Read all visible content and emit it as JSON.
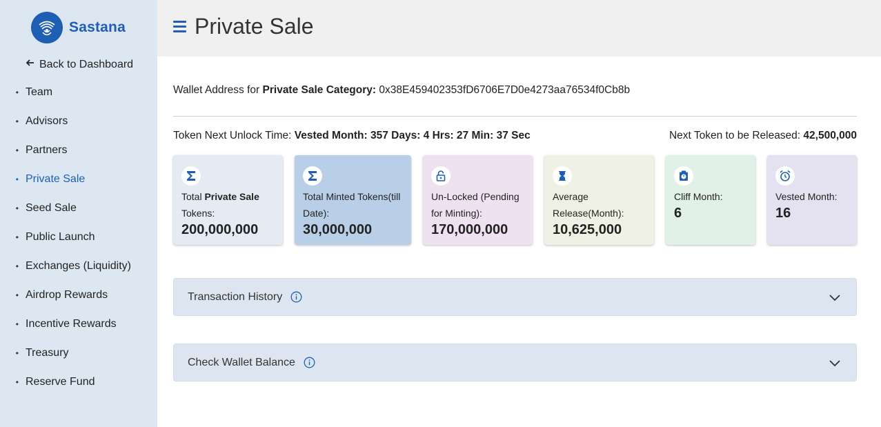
{
  "brand": {
    "name": "Sastana",
    "color": "#1e5fb3"
  },
  "sidebar": {
    "back_label": "Back to Dashboard",
    "items": [
      {
        "label": "Team",
        "active": false
      },
      {
        "label": "Advisors",
        "active": false
      },
      {
        "label": "Partners",
        "active": false
      },
      {
        "label": "Private Sale",
        "active": true
      },
      {
        "label": "Seed Sale",
        "active": false
      },
      {
        "label": "Public Launch",
        "active": false
      },
      {
        "label": "Exchanges (Liquidity)",
        "active": false
      },
      {
        "label": "Airdrop Rewards",
        "active": false
      },
      {
        "label": "Incentive Rewards",
        "active": false
      },
      {
        "label": "Treasury",
        "active": false
      },
      {
        "label": "Reserve Fund",
        "active": false
      }
    ]
  },
  "header": {
    "title": "Private Sale"
  },
  "wallet": {
    "prefix": "Wallet Address for",
    "category": "Private Sale Category:",
    "address": "0x38E459402353fD6706E7D0e4273aa76534f0Cb8b"
  },
  "unlock": {
    "label": "Token Next Unlock Time:",
    "value": "Vested Month: 357 Days: 4 Hrs: 27 Min: 37 Sec"
  },
  "next_release": {
    "label": "Next Token to be Released:",
    "value": "42,500,000"
  },
  "cards": [
    {
      "icon": "sigma-icon",
      "label_pre": "Total",
      "label_bold": "Private Sale",
      "label_post": "Tokens:",
      "value": "200,000,000",
      "bg": "#e4ebf3"
    },
    {
      "icon": "sigma-icon",
      "label": "Total Minted Tokens(till Date):",
      "value": "30,000,000",
      "bg": "#b9cfe8"
    },
    {
      "icon": "unlock-icon",
      "label": "Un-Locked (Pending for Minting):",
      "value": "170,000,000",
      "bg": "#eee1f0"
    },
    {
      "icon": "hourglass-icon",
      "label": "Average Release(Month):",
      "value": "10,625,000",
      "bg": "#eff1e4"
    },
    {
      "icon": "timer-icon",
      "label": "Cliff Month:",
      "value": "6",
      "bg": "#e1f1e7"
    },
    {
      "icon": "alarm-icon",
      "label": "Vested Month:",
      "value": "16",
      "bg": "#e4e1f1"
    }
  ],
  "accordions": [
    {
      "label": "Transaction History"
    },
    {
      "label": "Check Wallet Balance"
    }
  ]
}
